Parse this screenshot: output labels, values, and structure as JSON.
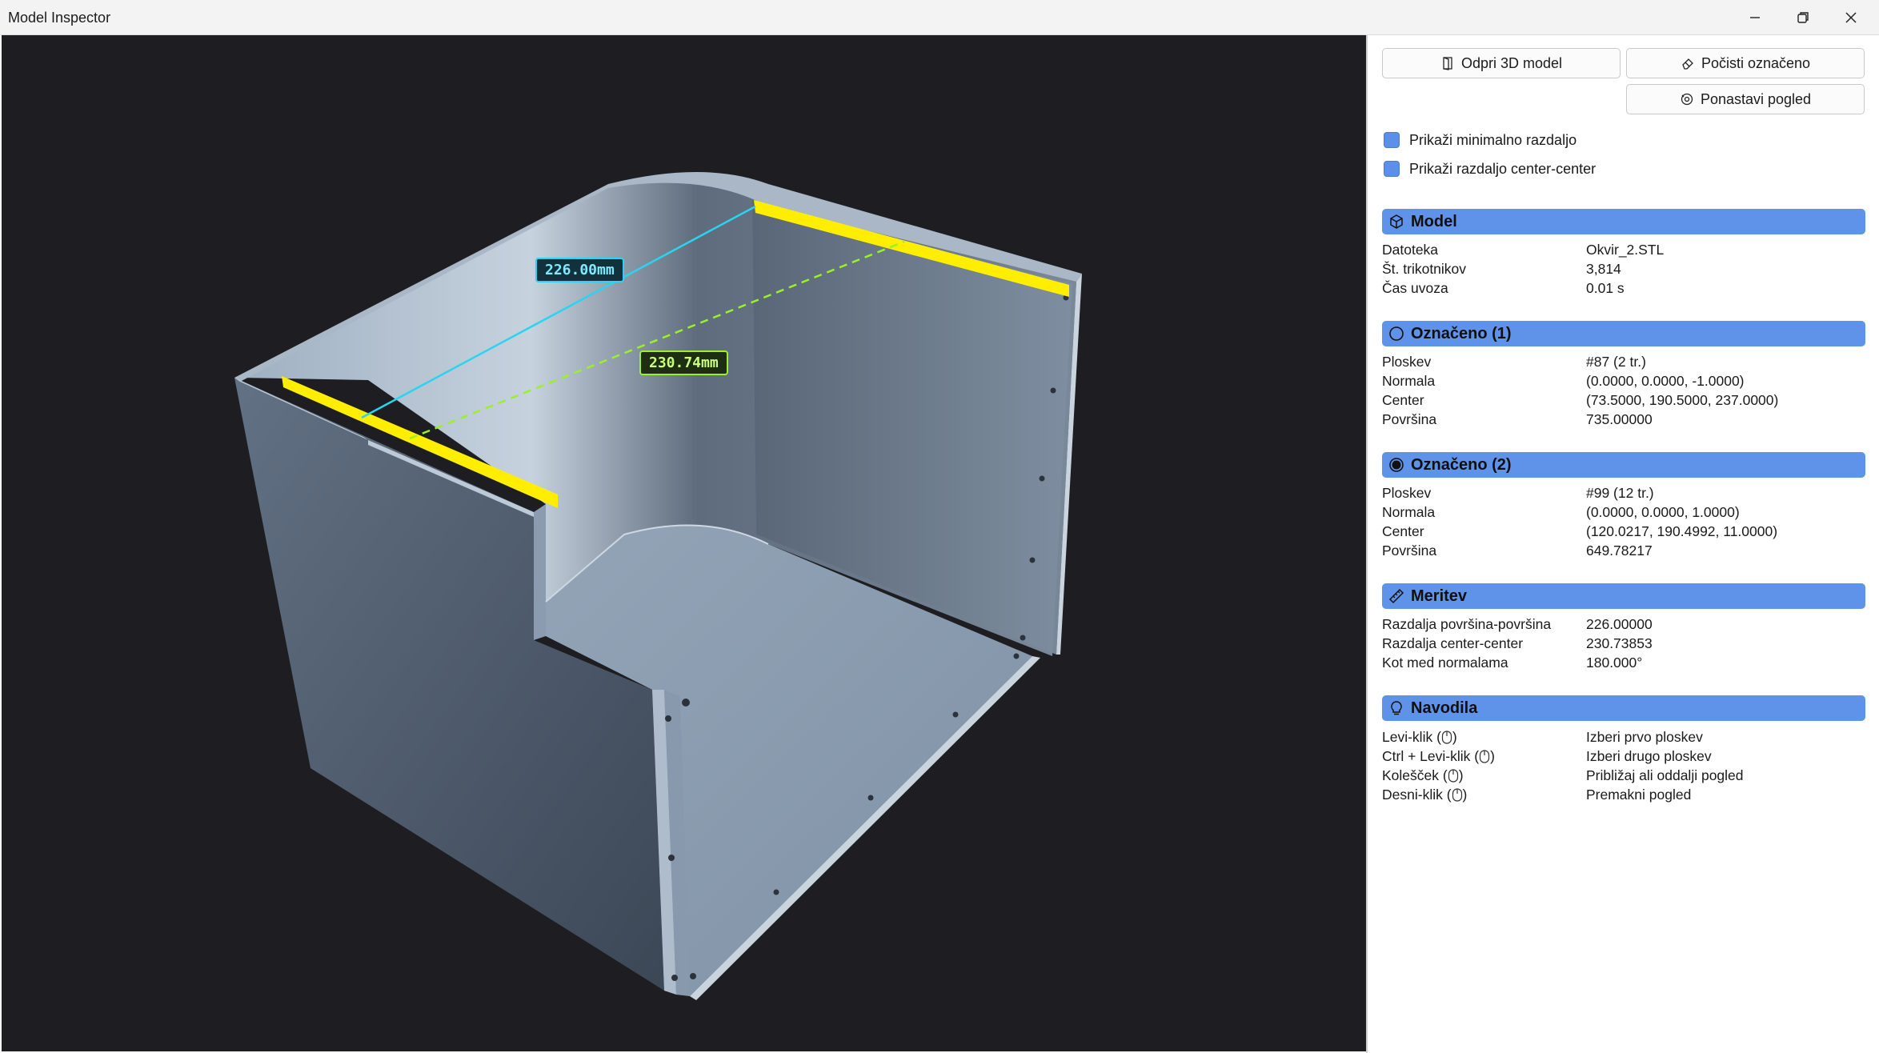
{
  "window": {
    "title": "Model Inspector"
  },
  "toolbar": {
    "open_model": "Odpri 3D model",
    "clear_selection": "Počisti označeno",
    "reset_view": "Ponastavi pogled"
  },
  "options": {
    "show_min_distance": {
      "label": "Prikaži minimalno razdaljo",
      "checked": true
    },
    "show_center_distance": {
      "label": "Prikaži razdaljo center-center",
      "checked": true
    }
  },
  "viewport": {
    "label_surface": "226.00mm",
    "label_center": "230.74mm",
    "colors": {
      "background": "#1e1e22",
      "highlight": "#ffee00",
      "surface_line": "#2ad4f0",
      "center_line": "#9cf028"
    }
  },
  "sections": {
    "model": {
      "title": "Model",
      "rows": [
        {
          "k": "Datoteka",
          "v": "Okvir_2.STL"
        },
        {
          "k": "Št. trikotnikov",
          "v": "3,814"
        },
        {
          "k": "Čas uvoza",
          "v": "0.01 s"
        }
      ]
    },
    "sel1": {
      "title": "Označeno (1)",
      "rows": [
        {
          "k": "Ploskev",
          "v": "#87 (2 tr.)"
        },
        {
          "k": "Normala",
          "v": "(0.0000, 0.0000, -1.0000)"
        },
        {
          "k": "Center",
          "v": "(73.5000, 190.5000, 237.0000)"
        },
        {
          "k": "Površina",
          "v": "735.00000"
        }
      ]
    },
    "sel2": {
      "title": "Označeno (2)",
      "rows": [
        {
          "k": "Ploskev",
          "v": "#99 (12 tr.)"
        },
        {
          "k": "Normala",
          "v": "(0.0000, 0.0000, 1.0000)"
        },
        {
          "k": "Center",
          "v": "(120.0217, 190.4992, 11.0000)"
        },
        {
          "k": "Površina",
          "v": "649.78217"
        }
      ]
    },
    "measure": {
      "title": "Meritev",
      "rows": [
        {
          "k": "Razdalja površina-površina",
          "v": "226.00000"
        },
        {
          "k": "Razdalja center-center",
          "v": "230.73853"
        },
        {
          "k": "Kot med normalama",
          "v": "180.000°"
        }
      ]
    },
    "help": {
      "title": "Navodila",
      "rows": [
        {
          "k": "Levi-klik (",
          "v": "Izberi prvo ploskev"
        },
        {
          "k": "Ctrl + Levi-klik (",
          "v": "Izberi drugo ploskev"
        },
        {
          "k": "Kolešček (",
          "v": "Približaj ali oddalji pogled"
        },
        {
          "k": "Desni-klik (",
          "v": "Premakni pogled"
        }
      ]
    }
  }
}
